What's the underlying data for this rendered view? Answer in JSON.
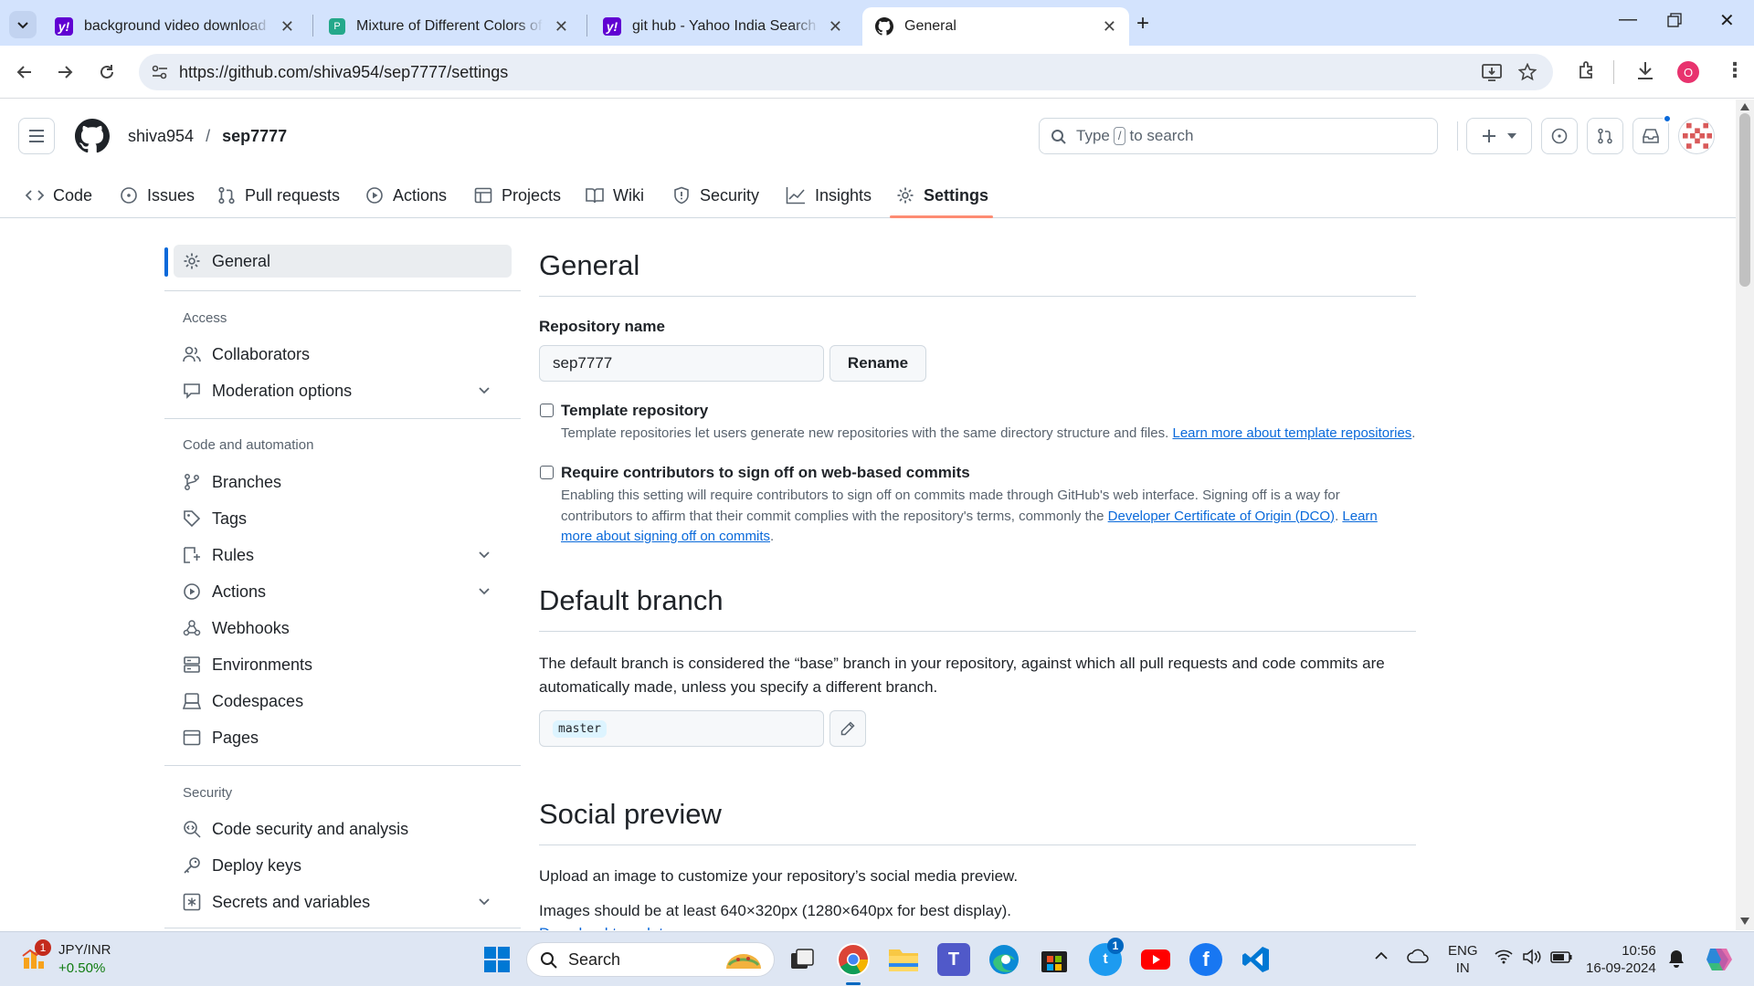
{
  "browser": {
    "tabs": [
      {
        "title": "background video download - Y",
        "favicon": "yahoo-icon"
      },
      {
        "title": "Mixture of Different Colors of In",
        "favicon": "doc-icon"
      },
      {
        "title": "git hub - Yahoo India Search Re",
        "favicon": "yahoo-icon"
      },
      {
        "title": "General",
        "favicon": "github-icon"
      }
    ],
    "url": "https://github.com/shiva954/sep7777/settings",
    "profile_initial": "O"
  },
  "github": {
    "owner": "shiva954",
    "separator": "/",
    "repo": "sep7777",
    "search_prefix": "Type",
    "search_key": "/",
    "search_suffix": "to search",
    "nav": [
      {
        "label": "Code",
        "icon": "code-icon"
      },
      {
        "label": "Issues",
        "icon": "issue-icon"
      },
      {
        "label": "Pull requests",
        "icon": "pull-request-icon"
      },
      {
        "label": "Actions",
        "icon": "play-icon"
      },
      {
        "label": "Projects",
        "icon": "table-icon"
      },
      {
        "label": "Wiki",
        "icon": "book-icon"
      },
      {
        "label": "Security",
        "icon": "shield-icon"
      },
      {
        "label": "Insights",
        "icon": "graph-icon"
      },
      {
        "label": "Settings",
        "icon": "gear-icon"
      }
    ]
  },
  "sidebar": {
    "general": "General",
    "access_heading": "Access",
    "access": [
      {
        "label": "Collaborators",
        "icon": "people-icon"
      },
      {
        "label": "Moderation options",
        "icon": "comment-icon"
      }
    ],
    "code_heading": "Code and automation",
    "code": [
      {
        "label": "Branches",
        "icon": "branch-icon"
      },
      {
        "label": "Tags",
        "icon": "tag-icon"
      },
      {
        "label": "Rules",
        "icon": "rules-icon"
      },
      {
        "label": "Actions",
        "icon": "play-icon"
      },
      {
        "label": "Webhooks",
        "icon": "webhook-icon"
      },
      {
        "label": "Environments",
        "icon": "server-icon"
      },
      {
        "label": "Codespaces",
        "icon": "codespaces-icon"
      },
      {
        "label": "Pages",
        "icon": "browser-icon"
      }
    ],
    "security_heading": "Security",
    "security": [
      {
        "label": "Code security and analysis",
        "icon": "codescan-icon"
      },
      {
        "label": "Deploy keys",
        "icon": "key-icon"
      },
      {
        "label": "Secrets and variables",
        "icon": "key-asterisk-icon"
      }
    ]
  },
  "main": {
    "title": "General",
    "repo_name_label": "Repository name",
    "repo_name_value": "sep7777",
    "rename_label": "Rename",
    "template_label": "Template repository",
    "template_desc": "Template repositories let users generate new repositories with the same directory structure and files.",
    "template_link": "Learn more about template repositories",
    "template_end": ".",
    "signoff_label": "Require contributors to sign off on web-based commits",
    "signoff_desc1": "Enabling this setting will require contributors to sign off on commits made through GitHub's web interface. Signing off is a way for contributors to affirm that their commit complies with the repository's terms, commonly the",
    "signoff_link1": "Developer Certificate of Origin (DCO)",
    "signoff_mid": ".",
    "signoff_link2": "Learn more about signing off on commits",
    "signoff_end": ".",
    "default_branch_title": "Default branch",
    "default_branch_desc": "The default branch is considered the “base” branch in your repository, against which all pull requests and code commits are automatically made, unless you specify a different branch.",
    "default_branch_value": "master",
    "social_title": "Social preview",
    "social_desc": "Upload an image to customize your repository’s social media preview.",
    "social_size": "Images should be at least 640×320px (1280×640px for best display).",
    "social_cut": "Download template"
  },
  "taskbar": {
    "ticker_name": "JPY/INR",
    "ticker_change": "+0.50%",
    "ticker_badge": "1",
    "search_label": "Search",
    "lang_top": "ENG",
    "lang_bottom": "IN",
    "time": "10:56",
    "date": "16-09-2024",
    "twitter_badge": "1"
  }
}
